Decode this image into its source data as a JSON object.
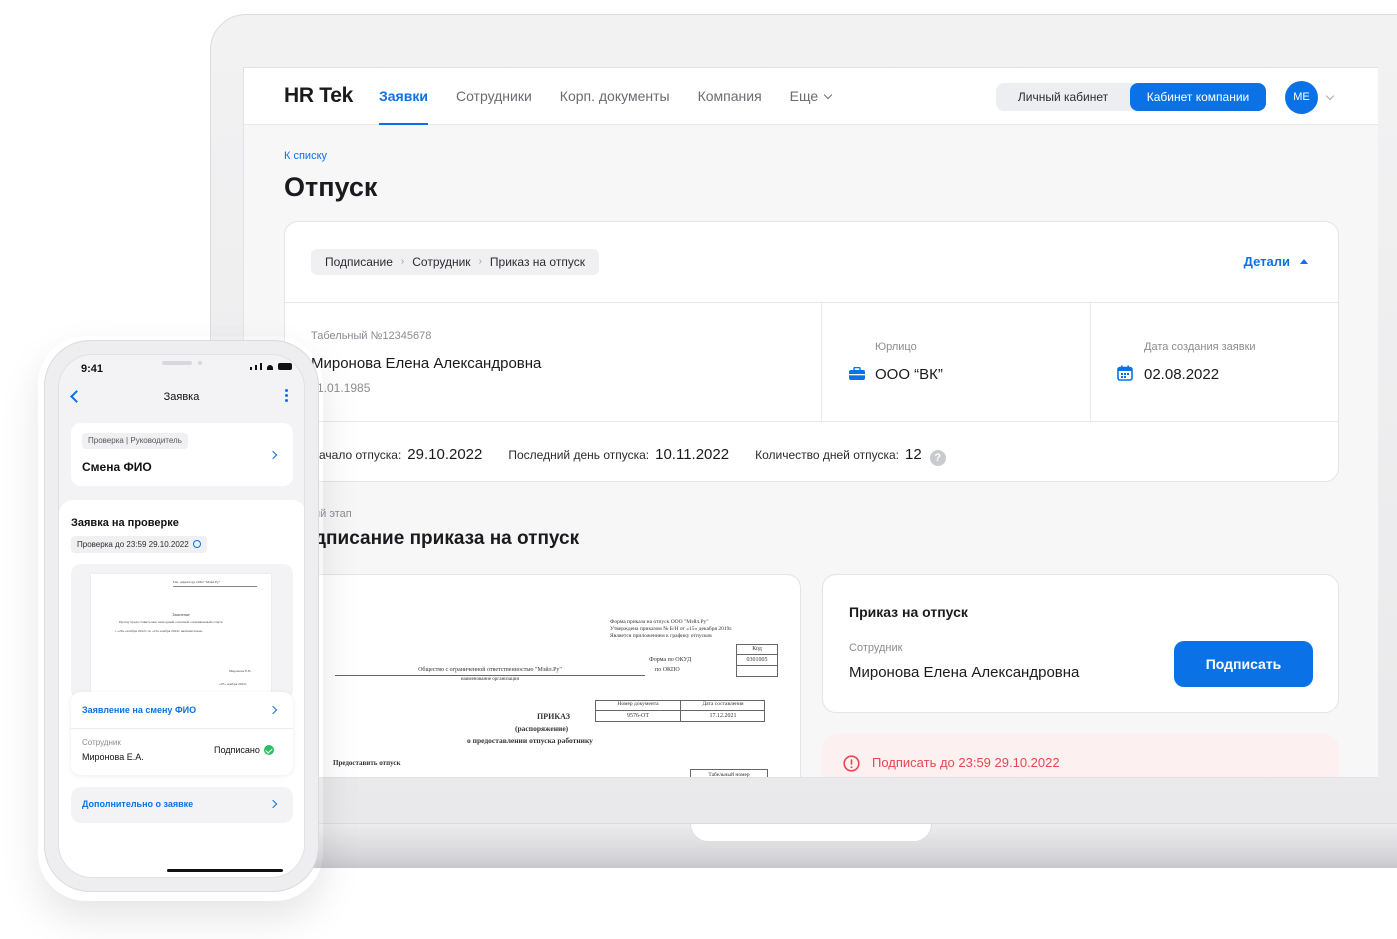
{
  "desktop": {
    "logo": "HR Tek",
    "nav": [
      "Заявки",
      "Сотрудники",
      "Корп. документы",
      "Компания",
      "Еще"
    ],
    "switch": {
      "personal": "Личный кабинет",
      "company": "Кабинет компании"
    },
    "avatar": "ME",
    "back_link": "К списку",
    "page_title": "Отпуск",
    "breadcrumb": [
      "Подписание",
      "Сотрудник",
      "Приказ на отпуск"
    ],
    "details_label": "Детали",
    "employee": {
      "tab_number": "Табельный №12345678",
      "name": "Миронова Елена Александровна",
      "birth_date": "1.01.1985"
    },
    "legal_entity": {
      "label": "Юрлицо",
      "value": "ООО “ВК”"
    },
    "created": {
      "label": "Дата создания заявки",
      "value": "02.08.2022"
    },
    "stats": [
      {
        "label": "ачало отпуска:",
        "value": "29.10.2022"
      },
      {
        "label": "Последний день отпуска:",
        "value": "10.11.2022"
      },
      {
        "label": "Количество дней отпуска:",
        "value": "12"
      }
    ],
    "help_mark": "?",
    "step_label": "ий этап",
    "step_title": "дписание приказа на отпуск",
    "document_preview": {
      "header_lines": [
        "Форма приказа на отпуск ООО \"Мэйл.Ру\"",
        "Утверждена приказом № Б/Н от «15» декабря 2019г.",
        "Является приложением к графику отпусков"
      ],
      "code_label": "Код",
      "okud_label": "Форма по ОКУД",
      "okud_value": "0301005",
      "okpo_label": "по ОКПО",
      "org_name": "Общество с ограниченной ответственностью \"Мэйл.Ру\"",
      "org_caption": "наименование организации",
      "doc_number_label": "Номер документа",
      "doc_date_label": "Дата составления",
      "doc_number": "9576-ОТ",
      "doc_date": "17.12.2021",
      "order_title": "ПРИКАЗ",
      "order_sub": "(распоряжение)",
      "order_about": "о предоставлении отпуска работнику",
      "grant_label": "Предоставить отпуск",
      "tab_label": "Табельный номер"
    },
    "sign_card": {
      "title": "Приказ на отпуск",
      "employee_label": "Сотрудник",
      "employee_name": "Миронова Елена Александровна",
      "button": "Подписать"
    },
    "deadline_warning": "Подписать до 23:59 29.10.2022",
    "colors": {
      "accent": "#0a72e6",
      "danger": "#e5484d",
      "success": "#2dbe60"
    }
  },
  "mobile": {
    "time": "9:41",
    "title": "Заявка",
    "request_card": {
      "tag": "Проверка | Руководитель",
      "title": "Смена ФИО"
    },
    "status_title": "Заявка на проверке",
    "deadline_chip": "Проверка до 23:59 29.10.2022",
    "doc_preview": {
      "addressee": "Ген. директору ООО \"Мэйл.Ру\"",
      "title": "Заявление",
      "body": "Прошу предоставить мне ежегодный основной оплачиваемый отпуск",
      "dates": "с «29» октября 2022г. по «10» ноября 2022г. включительно.",
      "signer": "Миронова Е.В.",
      "date": "«07» ноября 2022г."
    },
    "doc_link": "Заявление на смену ФИО",
    "employee_label": "Сотрудник",
    "employee_name": "Миронова Е.А.",
    "signed_status": "Подписано",
    "more_link": "Дополнительно о заявке",
    "icons": [
      "back-arrow-icon",
      "more-vertical-icon",
      "chevron-right-icon",
      "clock-icon",
      "check-circle-icon"
    ]
  }
}
